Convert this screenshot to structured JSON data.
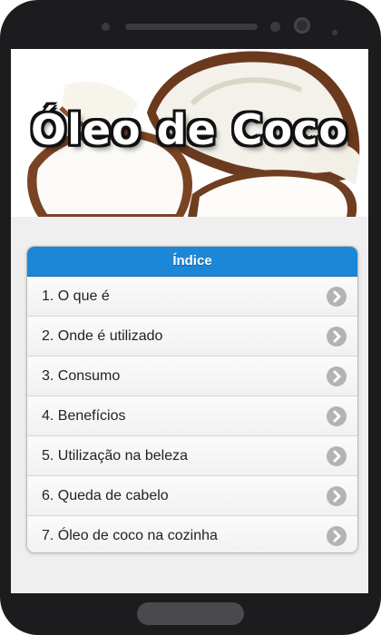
{
  "hero": {
    "title": "Óleo de Coco"
  },
  "index": {
    "header": "Índice",
    "items": [
      {
        "label": "1. O que é"
      },
      {
        "label": "2. Onde é utilizado"
      },
      {
        "label": "3. Consumo"
      },
      {
        "label": "4. Benefícios"
      },
      {
        "label": "5. Utilização na beleza"
      },
      {
        "label": "6. Queda de cabelo"
      },
      {
        "label": "7. Óleo de coco na cozinha"
      }
    ]
  },
  "icons": {
    "item_arrow": "chevron-right-icon"
  },
  "colors": {
    "header_blue": "#1b87d6",
    "phone_frame": "#1c1c1e",
    "screen_bg": "#efefef",
    "chevron_gray": "#b3b3b3"
  }
}
